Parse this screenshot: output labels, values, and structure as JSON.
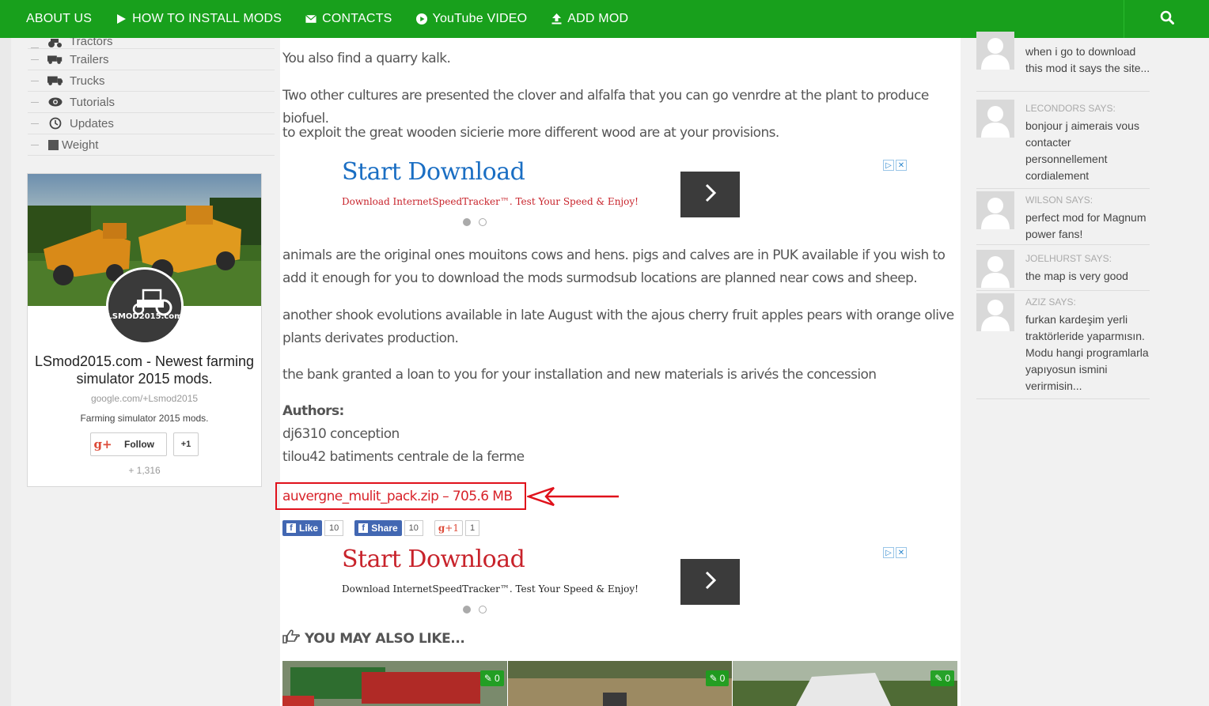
{
  "nav": {
    "items": [
      {
        "label": "ABOUT US",
        "icon": ""
      },
      {
        "label": "HOW TO INSTALL MODS",
        "icon": "play-icon"
      },
      {
        "label": "CONTACTS",
        "icon": "envelope-icon"
      },
      {
        "label": "YouTube VIDEO",
        "icon": "youtube-play-icon"
      },
      {
        "label": "ADD MOD",
        "icon": "upload-icon"
      }
    ],
    "search_icon": "search-icon",
    "bg_color": "#18a01c"
  },
  "sidebar": {
    "categories": [
      {
        "label": "Tractors",
        "icon": "tractor-icon"
      },
      {
        "label": "Trailers",
        "icon": "trailer-icon"
      },
      {
        "label": "Trucks",
        "icon": "truck-icon"
      },
      {
        "label": "Tutorials",
        "icon": "eye-icon"
      },
      {
        "label": "Updates",
        "icon": "history-icon"
      },
      {
        "label": "Weight",
        "icon": "square-icon"
      }
    ],
    "gplus_card": {
      "avatar_text": "LSMOD2015.com",
      "name": "LSmod2015.com - Newest farming simulator 2015 mods.",
      "url": "google.com/+Lsmod2015",
      "description": "Farming simulator 2015 mods.",
      "follow_label": "Follow",
      "plus_one_label": "+1",
      "follower_count": "+ 1,316"
    }
  },
  "article": {
    "paragraphs": [
      "You also find a quarry kalk.",
      "Two other cultures are presented the clover and alfalfa that you can go venrdre at the plant to produce biofuel.",
      "to exploit the great wooden sicierie more different wood are at your provisions.",
      "animals are the original ones mouitons cows and hens. pigs and calves are in PUK available if you wish to add it enough for you to download the mods surmodsub locations are planned near cows and sheep.",
      "another shook evolutions available in late August with the ajous cherry fruit apples pears with orange olive plants derivates production.",
      "the bank granted a loan to you for your installation and new materials is arivés the concession"
    ],
    "authors_label": "Authors:",
    "authors": [
      "dj6310 conception",
      "tilou42 batiments centrale de la ferme"
    ],
    "download_link": "auvergne_mulit_pack.zip – 705.6 MB",
    "ads": [
      {
        "title": "Start Download",
        "subtitle": "Download InternetSpeedTracker™. Test Your Speed & Enjoy!"
      },
      {
        "title": "Start Download",
        "subtitle": "Download InternetSpeedTracker™. Test Your Speed & Enjoy!"
      }
    ],
    "share": {
      "like_label": "Like",
      "like_count": "10",
      "share_label": "Share",
      "share_count": "10",
      "gplus_label": "+1",
      "gplus_count": "1"
    },
    "also_like_heading": "YOU MAY ALSO LIKE...",
    "related": [
      {
        "comments": "0"
      },
      {
        "comments": "0"
      },
      {
        "comments": "0"
      }
    ]
  },
  "comments": [
    {
      "author": "",
      "text": "when i go to download this mod it says the site..."
    },
    {
      "author": "LECONDORS SAYS:",
      "text": "bonjour j aimerais vous contacter personnellement cordialement"
    },
    {
      "author": "WILSON SAYS:",
      "text": "perfect mod for Magnum power fans!"
    },
    {
      "author": "JOELHURST SAYS:",
      "text": "the map is very good"
    },
    {
      "author": "AZIZ SAYS:",
      "text": "furkan kardeşim yerli traktörleride yaparmısın. Modu hangi programlarla yapıyosun ismini verirmisin..."
    }
  ]
}
